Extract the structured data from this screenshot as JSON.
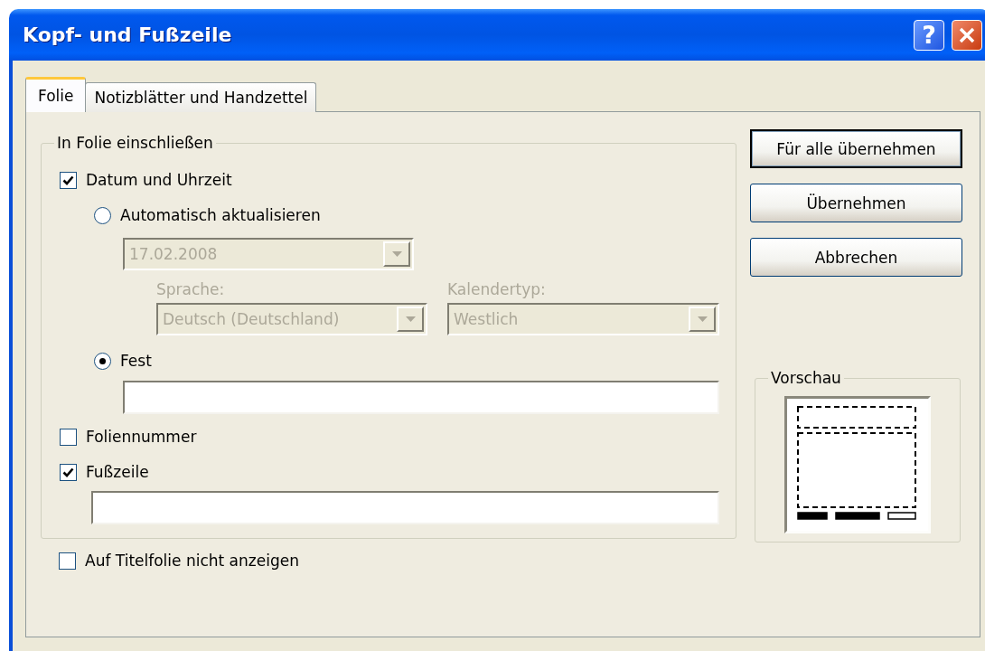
{
  "window": {
    "title": "Kopf- und Fußzeile"
  },
  "title_buttons": [
    {
      "kind": "help",
      "label": "?"
    },
    {
      "kind": "close"
    }
  ],
  "tabs": [
    {
      "label": "Folie",
      "selected": true
    },
    {
      "label": "Notizblätter und Handzettel",
      "selected": false
    }
  ],
  "include_group": {
    "title": "In Folie einschließen",
    "date_time": {
      "label": "Datum und Uhrzeit",
      "checked": true
    },
    "date_modes": [
      {
        "kind": "automatic",
        "label": "Automatisch aktualisieren",
        "selected": false,
        "date": {
          "value": "17.02.2008",
          "disabled": true
        },
        "language": {
          "label": "Sprache:",
          "value": "Deutsch (Deutschland)",
          "disabled": true
        },
        "calendar": {
          "label": "Kalendertyp:",
          "value": "Westlich",
          "disabled": true
        }
      },
      {
        "kind": "fixed",
        "label": "Fest",
        "selected": true
      }
    ],
    "slide_number": {
      "label": "Foliennummer",
      "checked": false
    },
    "footer": {
      "label": "Fußzeile",
      "checked": true
    }
  },
  "hide_on_title_slide": {
    "label": "Auf Titelfolie nicht anzeigen",
    "checked": false
  },
  "buttons": [
    {
      "label": "Für alle übernehmen",
      "default": true
    },
    {
      "label": "Übernehmen",
      "default": false
    },
    {
      "label": "Abbrechen",
      "default": false
    }
  ],
  "preview": {
    "title": "Vorschau"
  }
}
